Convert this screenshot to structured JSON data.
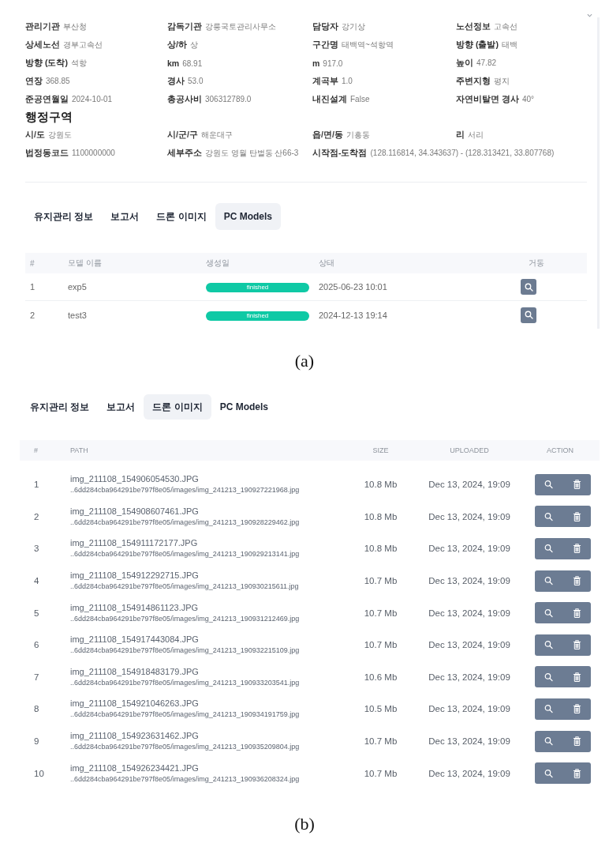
{
  "panel_a": {
    "info_fields": [
      {
        "label": "관리기관",
        "value": "부산청"
      },
      {
        "label": "감독기관",
        "value": "강릉국토관리사무소"
      },
      {
        "label": "담당자",
        "value": "강기상"
      },
      {
        "label": "노선정보",
        "value": "고속선"
      },
      {
        "label": "상세노선",
        "value": "경부고속선"
      },
      {
        "label": "상/하",
        "value": "상"
      },
      {
        "label": "구간명",
        "value": "태백역~석항역"
      },
      {
        "label": "방향 (출발)",
        "value": "태백"
      },
      {
        "label": "방향 (도착)",
        "value": "석항"
      },
      {
        "label": "km",
        "value": "68.91"
      },
      {
        "label": "m",
        "value": "917.0"
      },
      {
        "label": "높이",
        "value": "47.82"
      },
      {
        "label": "연장",
        "value": "368.85"
      },
      {
        "label": "경사",
        "value": "53.0"
      },
      {
        "label": "계곡부",
        "value": "1.0"
      },
      {
        "label": "주변지형",
        "value": "평지"
      },
      {
        "label": "준공연월일",
        "value": "2024-10-01"
      },
      {
        "label": "총공사비",
        "value": "306312789.0"
      },
      {
        "label": "내진설계",
        "value": "False"
      },
      {
        "label": "자연비탈면 경사",
        "value": "40°"
      }
    ],
    "section_title": "행정구역",
    "admin_fields": [
      {
        "label": "시/도",
        "value": "강원도"
      },
      {
        "label": "시/군/구",
        "value": "해운대구"
      },
      {
        "label": "읍/면/동",
        "value": "기흥동"
      },
      {
        "label": "리",
        "value": "서리"
      },
      {
        "label": "법정동코드",
        "value": "1100000000"
      },
      {
        "label": "세부주소",
        "value": "강원도 영월 탄벌동 산66-3"
      },
      {
        "label": "시작점-도착점",
        "value": "(128.116814, 34.343637) - (128.313421, 33.807768)"
      }
    ],
    "tabs": [
      {
        "label": "유지관리 정보",
        "selected": false
      },
      {
        "label": "보고서",
        "selected": false
      },
      {
        "label": "드론 이미지",
        "selected": false
      },
      {
        "label": "PC Models",
        "selected": true
      }
    ],
    "table": {
      "columns": [
        "#",
        "모델 이름",
        "생성일",
        "상태",
        "거동"
      ],
      "rows": [
        {
          "number": "1",
          "name": "exp5",
          "status": "finished",
          "date": "2025-06-23 10:01"
        },
        {
          "number": "2",
          "name": "test3",
          "status": "finished",
          "date": "2024-12-13 19:14"
        }
      ]
    },
    "caption": "(a)"
  },
  "panel_b": {
    "tabs": [
      {
        "label": "유지관리 정보",
        "selected": false
      },
      {
        "label": "보고서",
        "selected": false
      },
      {
        "label": "드론 이미지",
        "selected": true
      },
      {
        "label": "PC Models",
        "selected": false
      }
    ],
    "table": {
      "columns": [
        "#",
        "PATH",
        "SIZE",
        "UPLOADED",
        "ACTION"
      ],
      "rows": [
        {
          "number": "1",
          "name": "img_211108_154906054530.JPG",
          "path": "..6dd284cba964291be797f8e05/images/img_241213_190927221968.jpg",
          "size": "10.8 Mb",
          "uploaded": "Dec 13, 2024, 19:09"
        },
        {
          "number": "2",
          "name": "img_211108_154908607461.JPG",
          "path": "..6dd284cba964291be797f8e05/images/img_241213_190928229462.jpg",
          "size": "10.8 Mb",
          "uploaded": "Dec 13, 2024, 19:09"
        },
        {
          "number": "3",
          "name": "img_211108_154911172177.JPG",
          "path": "..6dd284cba964291be797f8e05/images/img_241213_190929213141.jpg",
          "size": "10.8 Mb",
          "uploaded": "Dec 13, 2024, 19:09"
        },
        {
          "number": "4",
          "name": "img_211108_154912292715.JPG",
          "path": "..6dd284cba964291be797f8e05/images/img_241213_190930215611.jpg",
          "size": "10.7 Mb",
          "uploaded": "Dec 13, 2024, 19:09"
        },
        {
          "number": "5",
          "name": "img_211108_154914861123.JPG",
          "path": "..6dd284cba964291be797f8e05/images/img_241213_190931212469.jpg",
          "size": "10.7 Mb",
          "uploaded": "Dec 13, 2024, 19:09"
        },
        {
          "number": "6",
          "name": "img_211108_154917443084.JPG",
          "path": "..6dd284cba964291be797f8e05/images/img_241213_190932215109.jpg",
          "size": "10.7 Mb",
          "uploaded": "Dec 13, 2024, 19:09"
        },
        {
          "number": "7",
          "name": "img_211108_154918483179.JPG",
          "path": "..6dd284cba964291be797f8e05/images/img_241213_190933203541.jpg",
          "size": "10.6 Mb",
          "uploaded": "Dec 13, 2024, 19:09"
        },
        {
          "number": "8",
          "name": "img_211108_154921046263.JPG",
          "path": "..6dd284cba964291be797f8e05/images/img_241213_190934191759.jpg",
          "size": "10.5 Mb",
          "uploaded": "Dec 13, 2024, 19:09"
        },
        {
          "number": "9",
          "name": "img_211108_154923631462.JPG",
          "path": "..6dd284cba964291be797f8e05/images/img_241213_190935209804.jpg",
          "size": "10.7 Mb",
          "uploaded": "Dec 13, 2024, 19:09"
        },
        {
          "number": "10",
          "name": "img_211108_154926234421.JPG",
          "path": "..6dd284cba964291be797f8e05/images/img_241213_190936208324.jpg",
          "size": "10.7 Mb",
          "uploaded": "Dec 13, 2024, 19:09"
        }
      ]
    },
    "caption": "(b)"
  }
}
